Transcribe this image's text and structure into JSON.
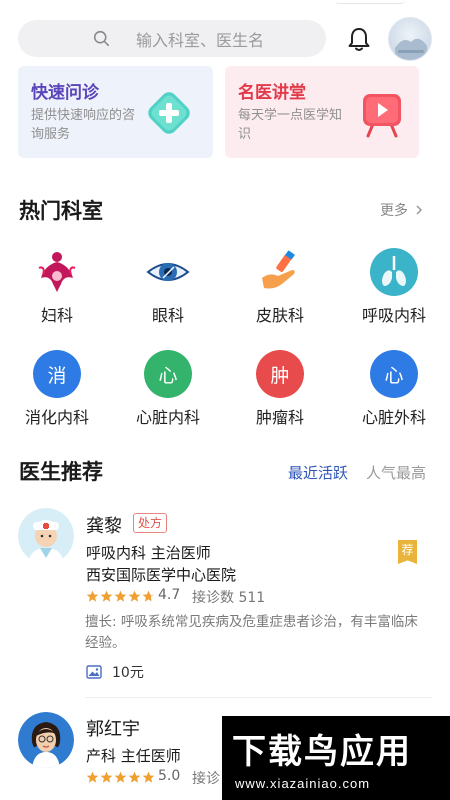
{
  "search": {
    "placeholder": "输入科室、医生名"
  },
  "promo": [
    {
      "title": "快速问诊",
      "subtitle": "提供快速响应的咨询服务"
    },
    {
      "title": "名医讲堂",
      "subtitle": "每天学一点医学知识"
    }
  ],
  "departments": {
    "title": "热门科室",
    "more": "更多",
    "items": [
      {
        "label": "妇科",
        "icon": "gynecology-icon"
      },
      {
        "label": "眼科",
        "icon": "eye-icon"
      },
      {
        "label": "皮肤科",
        "icon": "skin-icon"
      },
      {
        "label": "呼吸内科",
        "icon": "lungs-icon"
      },
      {
        "label": "消化内科",
        "glyph": "消",
        "color": "#2f7be6"
      },
      {
        "label": "心脏内科",
        "glyph": "心",
        "color": "#33b36b"
      },
      {
        "label": "肿瘤科",
        "glyph": "肿",
        "color": "#e84b4b"
      },
      {
        "label": "心脏外科",
        "glyph": "心",
        "color": "#2f7be6"
      }
    ]
  },
  "doctors": {
    "title": "医生推荐",
    "tabs": [
      "最近活跃",
      "人气最高"
    ],
    "list": [
      {
        "name": "龚黎",
        "badge": "处方",
        "dept_title": "呼吸内科  主治医师",
        "hospital": "西安国际医学中心医院",
        "rating": "4.7",
        "stars": 4.7,
        "consult": "接诊数 511",
        "bio": "擅长: 呼吸系统常见疾病及危重症患者诊治，有丰富临床经验。",
        "price": "10元",
        "tag": "荐"
      },
      {
        "name": "郭红宇",
        "dept_title": "产科  主任医师",
        "rating": "5.0",
        "stars": 5,
        "consult": "接诊"
      }
    ]
  },
  "watermark": {
    "brand": "下载鸟应用",
    "url": "www.xiazainiao.com"
  },
  "colors": {
    "accent": "#2e55b8",
    "star": "#f0a030",
    "danger": "#e0544b"
  }
}
